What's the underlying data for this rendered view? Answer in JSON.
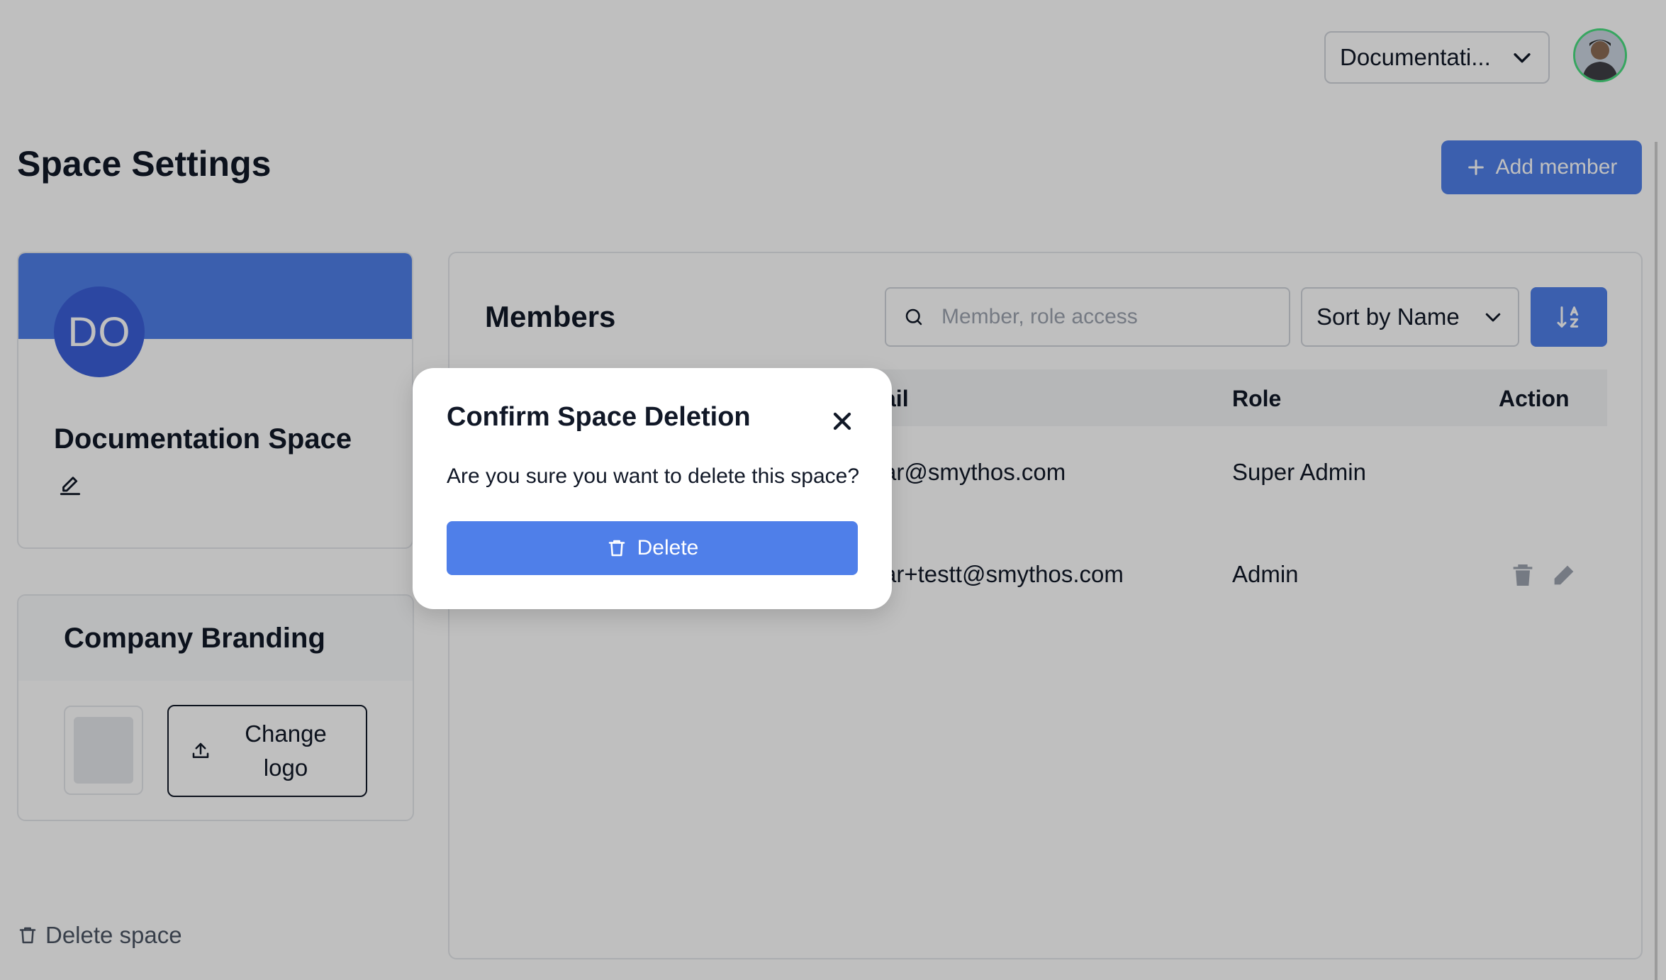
{
  "header": {
    "space_select_label": "Documentati...",
    "avatar": "user-avatar"
  },
  "page": {
    "title": "Space Settings",
    "add_member_label": "Add member"
  },
  "space_card": {
    "initials": "DO",
    "name": "Documentation Space"
  },
  "branding": {
    "title": "Company Branding",
    "change_logo_label": "Change logo"
  },
  "delete_space_label": "Delete space",
  "members": {
    "title": "Members",
    "search_placeholder": "Member, role access",
    "sort_label": "Sort by Name",
    "columns": {
      "email": "ail",
      "role": "Role",
      "action": "Action"
    },
    "rows": [
      {
        "email": "ar@smythos.com",
        "role": "Super Admin"
      },
      {
        "email": "ar+testt@smythos.com",
        "role": "Admin"
      }
    ]
  },
  "modal": {
    "title": "Confirm Space Deletion",
    "message": "Are you sure you want to delete this space?",
    "delete_label": "Delete"
  },
  "colors": {
    "accent": "#4f7fe9",
    "avatar_ring": "#4ade80"
  }
}
